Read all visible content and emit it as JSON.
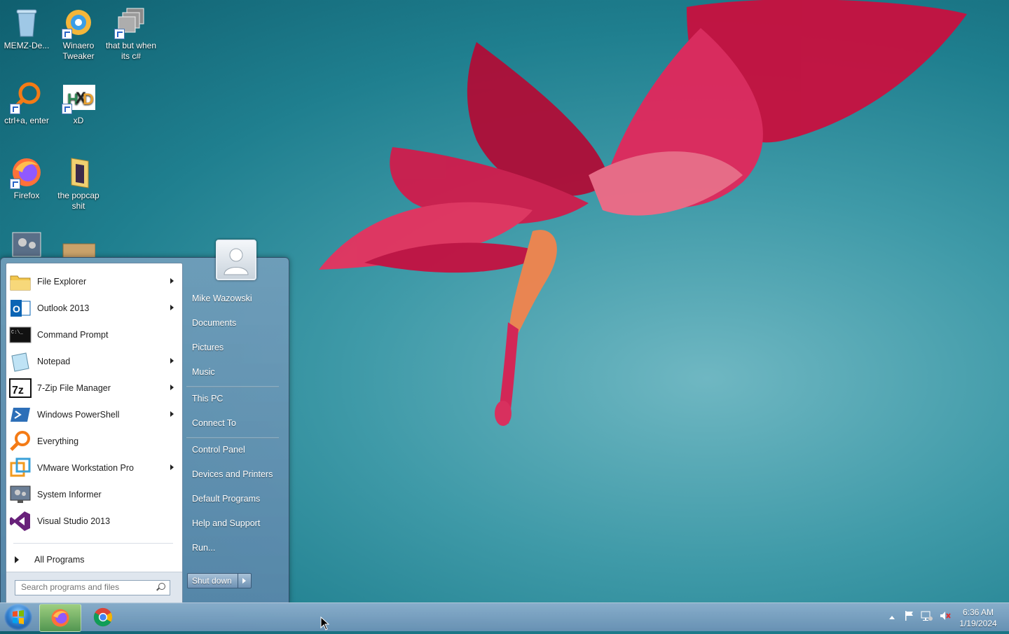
{
  "desktop": {
    "icons": [
      {
        "label": "MEMZ-De...",
        "icon": "recycle-bin-icon"
      },
      {
        "label": "Winaero Tweaker",
        "icon": "winaero-icon"
      },
      {
        "label": "that but when its c#",
        "icon": "windows-stack-icon"
      },
      {
        "label": "ctrl+a, enter",
        "icon": "everything-search-icon"
      },
      {
        "label": "xD",
        "icon": "hxd-icon"
      },
      {
        "label": "Firefox",
        "icon": "firefox-icon"
      },
      {
        "label": "the popcap shit",
        "icon": "folder-icon"
      }
    ]
  },
  "start_menu": {
    "pinned": [
      {
        "label": "File Explorer",
        "icon": "folder-icon",
        "has_submenu": true
      },
      {
        "label": "Outlook 2013",
        "icon": "outlook-icon",
        "has_submenu": true
      },
      {
        "label": "Command Prompt",
        "icon": "cmd-icon",
        "has_submenu": false
      },
      {
        "label": "Notepad",
        "icon": "notepad-icon",
        "has_submenu": true
      },
      {
        "label": "7-Zip File Manager",
        "icon": "7zip-icon",
        "has_submenu": true
      },
      {
        "label": "Windows PowerShell",
        "icon": "powershell-icon",
        "has_submenu": true
      },
      {
        "label": "Everything",
        "icon": "everything-icon",
        "has_submenu": false
      },
      {
        "label": "VMware Workstation Pro",
        "icon": "vmware-icon",
        "has_submenu": true
      },
      {
        "label": "System Informer",
        "icon": "system-informer-icon",
        "has_submenu": false
      },
      {
        "label": "Visual Studio 2013",
        "icon": "visual-studio-icon",
        "has_submenu": false
      }
    ],
    "all_programs": "All Programs",
    "search_placeholder": "Search programs and files",
    "right": {
      "user": "Mike Wazowski",
      "documents": "Documents",
      "pictures": "Pictures",
      "music": "Music",
      "this_pc": "This PC",
      "connect_to": "Connect To",
      "control_panel": "Control Panel",
      "devices": "Devices and Printers",
      "default_programs": "Default Programs",
      "help": "Help and Support",
      "run": "Run..."
    },
    "shutdown_label": "Shut down"
  },
  "taskbar": {
    "pinned": [
      {
        "name": "firefox-icon",
        "active": true
      },
      {
        "name": "chrome-icon",
        "active": false
      }
    ],
    "clock_time": "6:36 AM",
    "clock_date": "1/19/2024"
  },
  "colors": {
    "accent": "#6d91b3",
    "wallpaper_teal": "#3f9aa8",
    "flower": "#e0245a"
  }
}
